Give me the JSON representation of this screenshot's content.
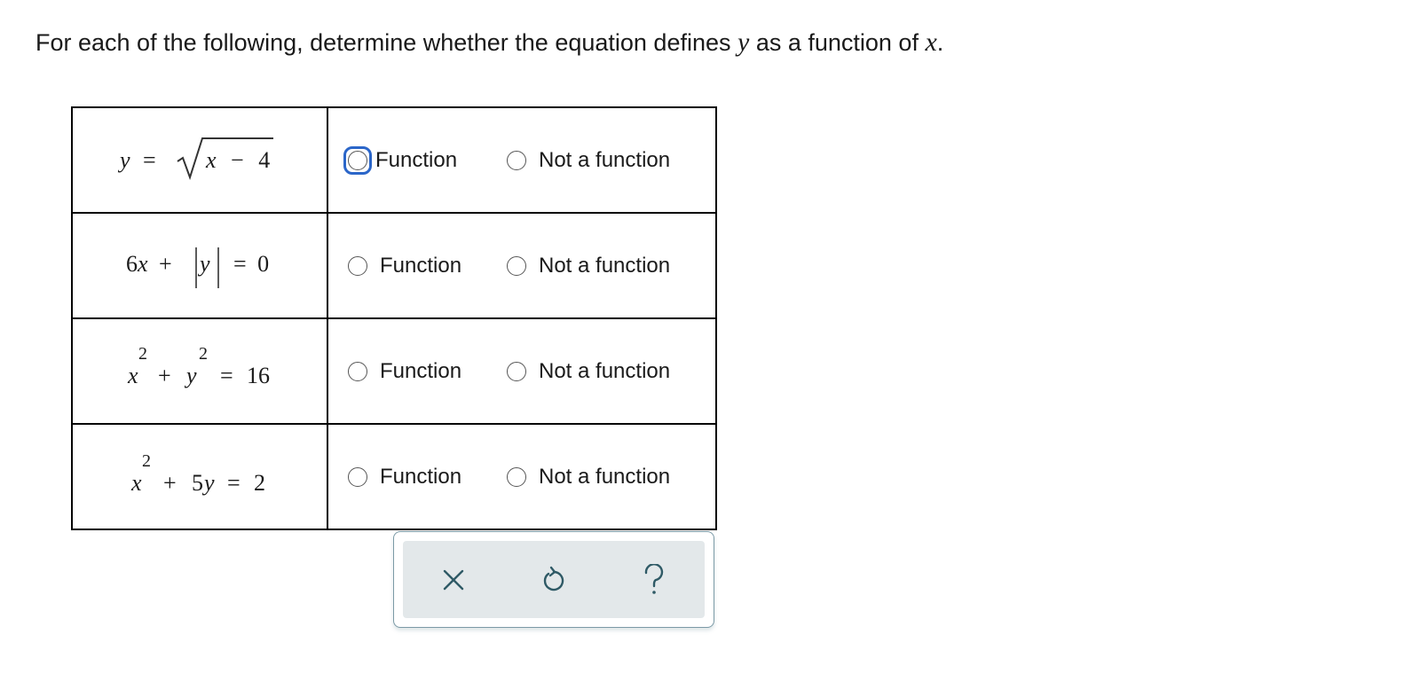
{
  "prompt": {
    "before": "For each of the following, determine whether the equation defines ",
    "var_y": "y",
    "middle": " as a function of ",
    "var_x": "x",
    "end": "."
  },
  "rows": [
    {
      "equation": {
        "y": "y",
        "eq": "=",
        "x": "x",
        "minus": "−",
        "four": "4"
      },
      "option_function": "Function",
      "option_not_function": "Not a function"
    },
    {
      "equation": {
        "six_x": "6",
        "x": "x",
        "plus": "+",
        "y": "y",
        "eq": "=",
        "zero": "0"
      },
      "option_function": "Function",
      "option_not_function": "Not a function"
    },
    {
      "equation": {
        "x": "x",
        "exp1": "2",
        "plus": "+",
        "y": "y",
        "exp2": "2",
        "eq": "=",
        "rhs": "16"
      },
      "option_function": "Function",
      "option_not_function": "Not a function"
    },
    {
      "equation": {
        "x": "x",
        "exp": "2",
        "plus": "+",
        "five": "5",
        "y": "y",
        "eq": "=",
        "rhs": "2"
      },
      "option_function": "Function",
      "option_not_function": "Not a function"
    }
  ],
  "toolbar": {
    "clear_icon": "close-icon",
    "undo_icon": "undo-icon",
    "help_icon": "help-icon",
    "icon_color": "#2f5a66"
  },
  "colors": {
    "focus_ring": "#2b66c9",
    "toolbar_bg": "#e3e8ea",
    "toolbar_border": "#7b9aa6"
  }
}
